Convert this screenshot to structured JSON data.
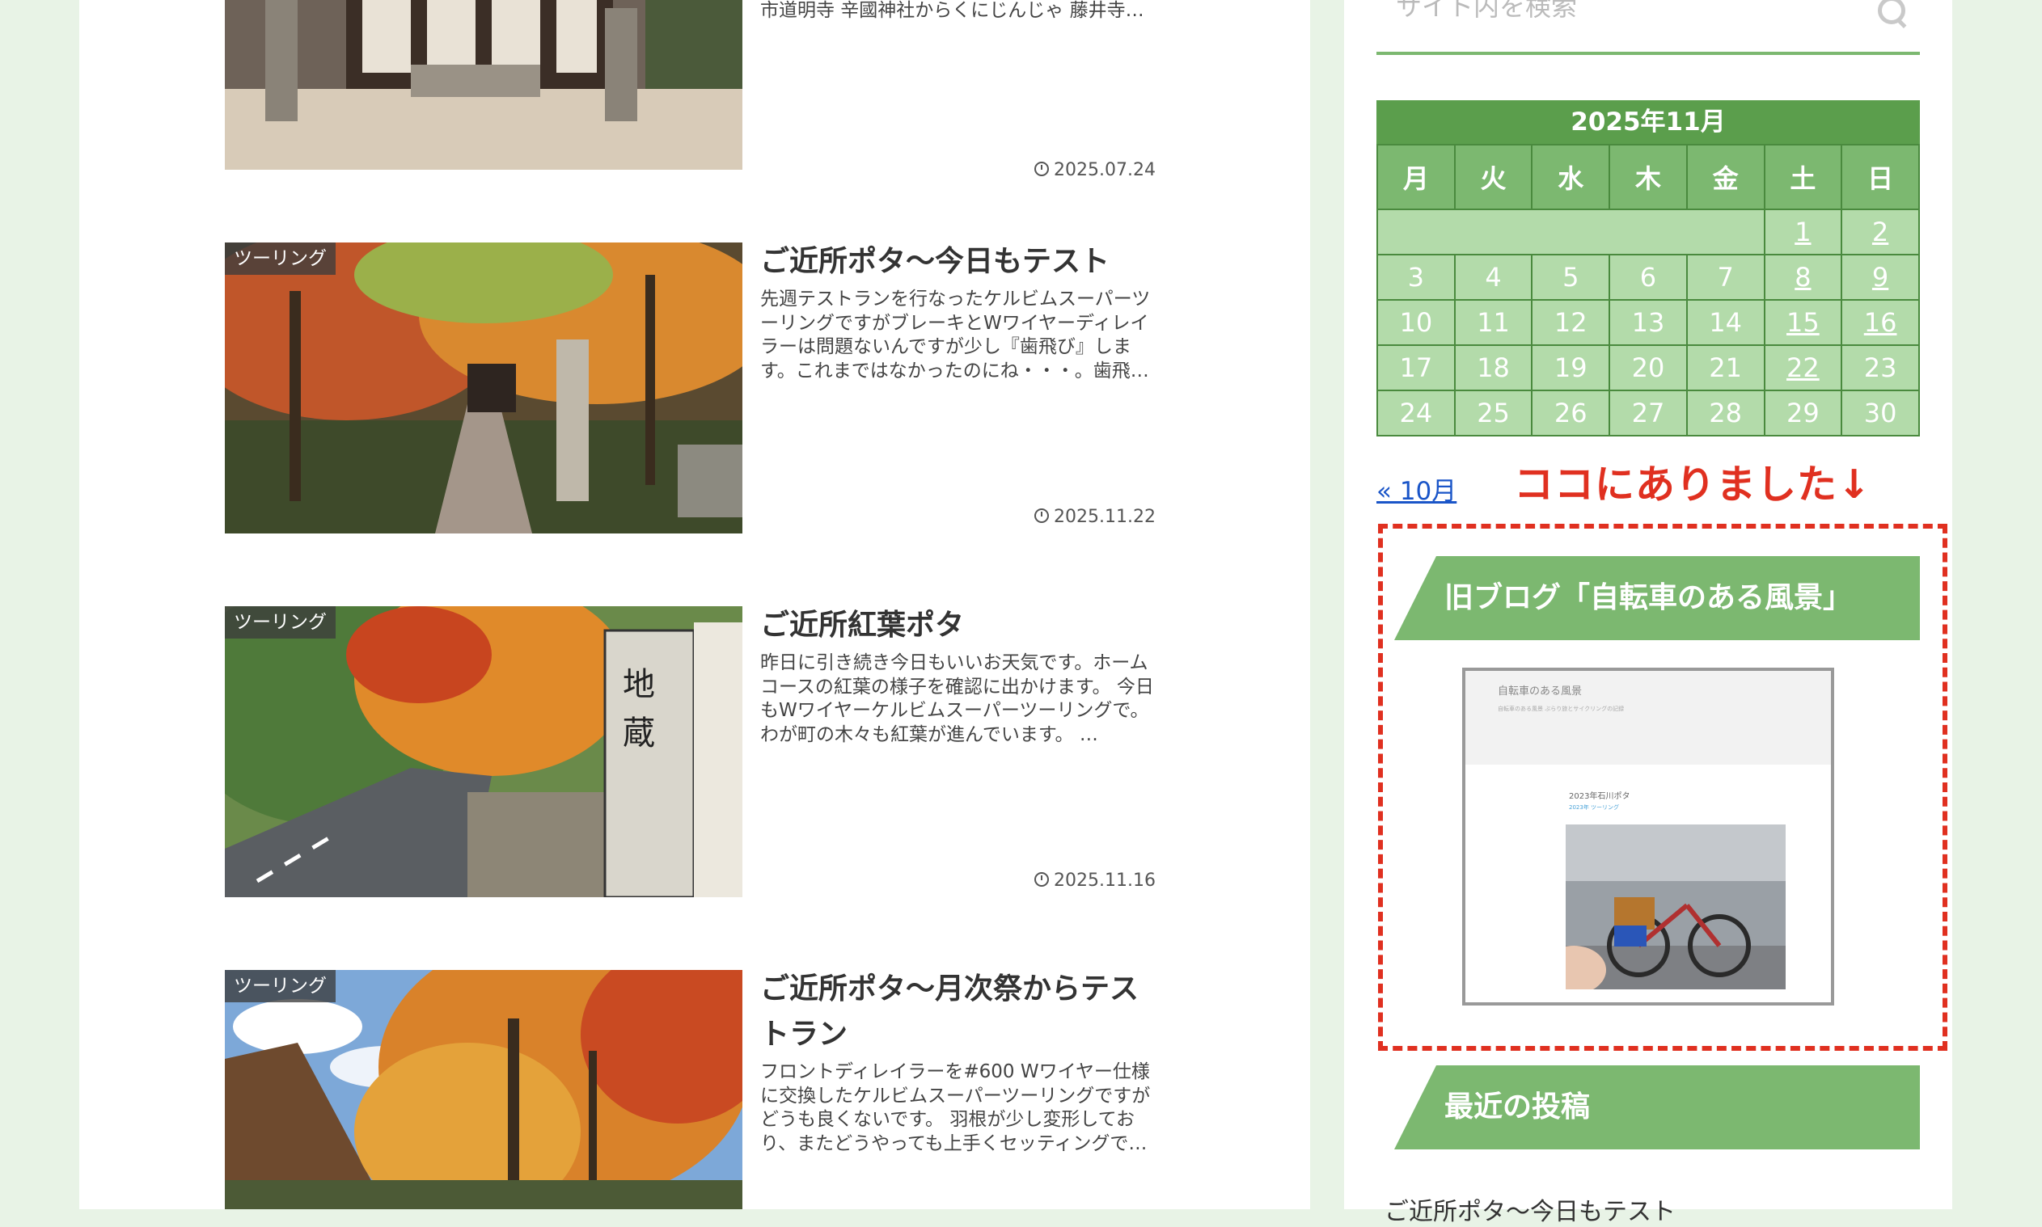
{
  "posts": [
    {
      "tag": "",
      "title": "",
      "excerpt": "市道明寺 辛國神社からくにじんじゃ 藤井寺…",
      "date": "2025.07.24"
    },
    {
      "tag": "ツーリング",
      "title": "ご近所ポタ〜今日もテスト",
      "excerpt": "先週テストランを行なったケルビムスーパーツーリングですがブレーキとWワイヤーディレイラーは問題ないんですが少し『歯飛び』します。これまではなかったのにね・・・。歯飛…",
      "date": "2025.11.22"
    },
    {
      "tag": "ツーリング",
      "title": "ご近所紅葉ポタ",
      "excerpt": "昨日に引き続き今日もいいお天気です。ホームコースの紅葉の様子を確認に出かけます。 今日もWワイヤーケルビムスーパーツーリングで。わが町の木々も紅葉が進んでいます。 …",
      "date": "2025.11.16"
    },
    {
      "tag": "ツーリング",
      "title": "ご近所ポタ〜月次祭からテストラン",
      "excerpt": "フロントディレイラーを#600 Wワイヤー仕様に交換したケルビムスーパーツーリングですがどうも良くないです。 羽根が少し変形しており、またどうやっても上手くセッティングで…",
      "date": ""
    }
  ],
  "sidebar": {
    "search_placeholder": "サイト内を検索",
    "calendar": {
      "caption": "2025年11月",
      "weekdays": [
        "月",
        "火",
        "水",
        "木",
        "金",
        "土",
        "日"
      ],
      "weeks": [
        [
          "",
          "",
          "",
          "",
          "",
          "1",
          "2"
        ],
        [
          "3",
          "4",
          "5",
          "6",
          "7",
          "8",
          "9"
        ],
        [
          "10",
          "11",
          "12",
          "13",
          "14",
          "15",
          "16"
        ],
        [
          "17",
          "18",
          "19",
          "20",
          "21",
          "22",
          "23"
        ],
        [
          "24",
          "25",
          "26",
          "27",
          "28",
          "29",
          "30"
        ]
      ],
      "linked_days": [
        "1",
        "2",
        "8",
        "9",
        "15",
        "16",
        "22"
      ],
      "prev_link": "« 10月"
    },
    "annotation": "ココにありました↓",
    "old_blog_heading": "旧ブログ「自転車のある風景」",
    "banner": {
      "title": "自転車のある風景",
      "subtitle": "自転車のある風景 ぶらり旅とサイクリングの記録",
      "post_title": "2023年石川ポタ",
      "post_meta": "2023年 ツーリング"
    },
    "recent_heading": "最近の投稿",
    "recent_items": [
      "ご近所ポタ〜今日もテスト"
    ]
  },
  "colors": {
    "accent_green": "#7cb870",
    "calendar_header": "#5b9e4c",
    "annotation_red": "#e03020",
    "link_blue": "#1a55c8"
  }
}
